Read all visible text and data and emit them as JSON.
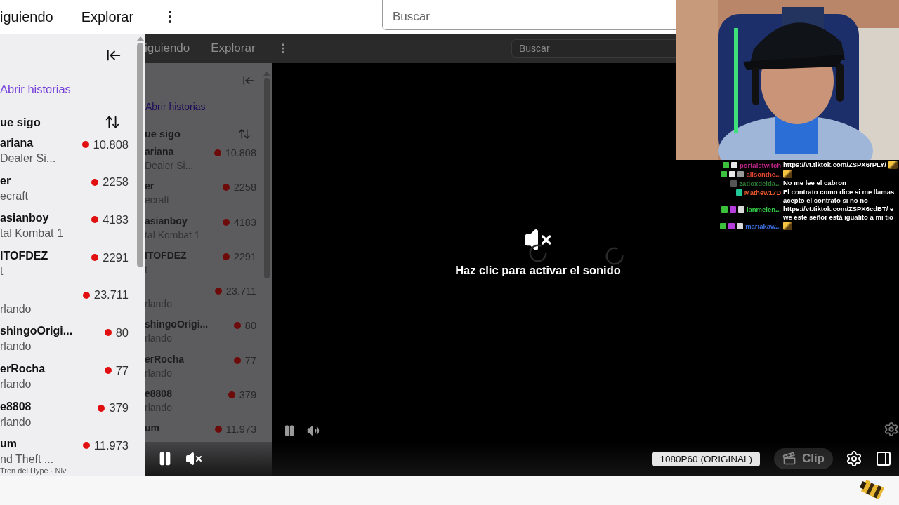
{
  "top_nav": {
    "links": [
      "iguiendo",
      "Explorar"
    ],
    "search": {
      "placeholder": "Buscar"
    }
  },
  "sidebar": {
    "stories_link": "Abrir historias",
    "section_title": "ue sigo",
    "channels": [
      {
        "name": "ariana",
        "game": "Dealer Si...",
        "viewers": "10.808"
      },
      {
        "name": "er",
        "game": "ecraft",
        "viewers": "2258"
      },
      {
        "name": "asianboy",
        "game": "tal Kombat 1",
        "viewers": "4183"
      },
      {
        "name": "ITOFDEZ",
        "game": "t",
        "viewers": "2291"
      },
      {
        "game": "rlando",
        "viewers": "23.711"
      },
      {
        "name": "shingoOrigi...",
        "game": "rlando",
        "viewers": "80"
      },
      {
        "name": "erRocha",
        "game": "rlando",
        "viewers": "77"
      },
      {
        "name": "e8808",
        "game": "rlando",
        "viewers": "379"
      },
      {
        "name": "um",
        "game": "nd Theft ...",
        "viewers": "11.973",
        "extra": "Tren del Hype · Niv"
      }
    ]
  },
  "stream": {
    "nested_screen": {
      "top_nav": {
        "links": [
          "iguiendo",
          "Explorar"
        ],
        "search": {
          "placeholder": "Buscar"
        }
      },
      "sidebar": {
        "stories_link": "Abrir historias",
        "section_title": "ue sigo",
        "channels": [
          {
            "name": "ariana",
            "game": "Dealer Si...",
            "viewers": "10.808"
          },
          {
            "name": "er",
            "game": "ecraft",
            "viewers": "2258"
          },
          {
            "name": "asianboy",
            "game": "tal Kombat 1",
            "viewers": "4183"
          },
          {
            "name": "ITOFDEZ",
            "game": "t",
            "viewers": "2291"
          },
          {
            "game": "rlando",
            "viewers": "23.711"
          },
          {
            "name": "shingoOrigi...",
            "game": "rlando",
            "viewers": "80"
          },
          {
            "name": "erRocha",
            "game": "rlando",
            "viewers": "77"
          },
          {
            "name": "e8808",
            "game": "rlando",
            "viewers": "379"
          },
          {
            "name": "um",
            "viewers": "11.973"
          }
        ]
      }
    },
    "unmute_prompt": "Haz clic para activar el sonido",
    "chat": [
      {
        "badges": [
          {
            "kind": "check"
          },
          {
            "kind": "mod"
          }
        ],
        "user": "portalstwitch",
        "color": "#c0268a",
        "text": "https://vt.tiktok.com/ZSPX6rPLY/",
        "emote": true
      },
      {
        "badges": [
          {
            "kind": "check"
          },
          {
            "kind": "mod"
          },
          {
            "kind": "speaker"
          }
        ],
        "user": "alisonthe...",
        "color": "#e0452f",
        "emote": true
      },
      {
        "badges": [
          {
            "kind": "eye"
          }
        ],
        "user": "zatloxdeida...",
        "color": "#2f7a35",
        "text": "No me lee el cabron",
        "emote": false
      },
      {
        "badges": [
          {
            "kind": "sub"
          }
        ],
        "user": "Mathew17D",
        "color": "#e8582c",
        "text": "El contrato como dice si me llamas acepto el contrato si no no",
        "emote": false
      },
      {
        "badges": [
          {
            "kind": "check"
          },
          {
            "kind": "prime"
          },
          {
            "kind": "gift"
          }
        ],
        "user": "ianmelen...",
        "color": "#35d04a",
        "text": "https://vt.tiktok.com/ZSPX6cdBT/ e we este señor está igualito a mi tio",
        "emote": false
      },
      {
        "badges": [
          {
            "kind": "check"
          },
          {
            "kind": "prime"
          },
          {
            "kind": "gift"
          }
        ],
        "user": "mariakaw...",
        "color": "#3d6fe0",
        "emote": true
      }
    ]
  },
  "player_controls": {
    "quality": "1080P60 (ORIGINAL)",
    "clip": "Clip"
  }
}
